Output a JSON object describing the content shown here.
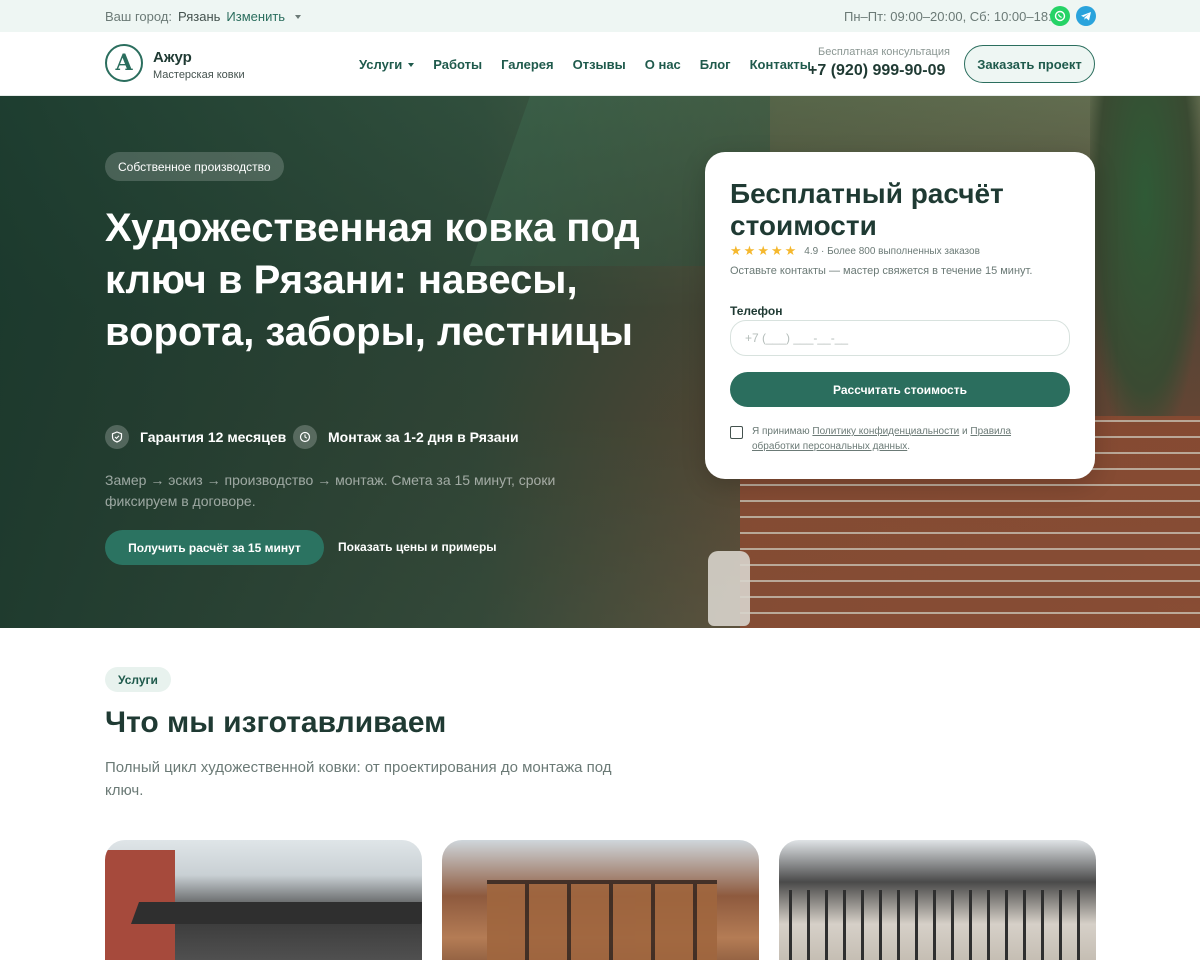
{
  "topbar": {
    "city_label": "Ваш город:",
    "city_name": "Рязань",
    "change_label": "Изменить",
    "hours": "Пн–Пт: 09:00–20:00, Сб: 10:00–18:00",
    "social": [
      "whatsapp-icon",
      "telegram-icon"
    ]
  },
  "header": {
    "logo_letter": "A",
    "logo_title": "Ажур",
    "logo_subtitle": "Мастерская ковки",
    "nav": [
      "Услуги",
      "Работы",
      "Галерея",
      "Отзывы",
      "О нас",
      "Блог",
      "Контакты"
    ],
    "consult_label": "Бесплатная консультация",
    "phone": "+7 (920) 999-90-09",
    "order_button": "Заказать проект"
  },
  "hero": {
    "badge": "Собственное производство",
    "title": "Художественная ковка под ключ в Рязани: навесы, ворота, заборы, лестницы",
    "features": [
      {
        "icon": "shield-icon",
        "label": "Гарантия 12 месяцев"
      },
      {
        "icon": "clock-icon",
        "label": "Монтаж за 1-2 дня в Рязани"
      }
    ],
    "description": "Замер → эскиз → производство → монтаж. Смета за 15 минут, сроки фиксируем в договоре.",
    "cta_primary": "Получить расчёт за 15 минут",
    "cta_secondary": "Показать цены и примеры"
  },
  "form": {
    "title": "Бесплатный расчёт стоимости",
    "rating_stars": 5,
    "rating_text": "4.9 · Более 800 выполненных заказов",
    "subtitle": "Оставьте контакты — мастер свяжется в течение 15 минут.",
    "phone_label": "Телефон",
    "phone_placeholder": "+7 (___) ___-__-__",
    "phone_value": "",
    "submit": "Рассчитать стоимость",
    "consent_prefix": "Я принимаю",
    "consent_link1": "Политику конфиденциальности",
    "consent_and": "и",
    "consent_link2": "Правила обработки персональных данных",
    "consent_checked": false
  },
  "services": {
    "badge": "Услуги",
    "title": "Что мы изготавливаем",
    "description": "Полный цикл художественной ковки: от проектирования до монтажа под ключ."
  },
  "colors": {
    "accent": "#2b6e5e",
    "dark": "#1f3a33",
    "topbar_bg": "#eef6f3",
    "star": "#f5b82e"
  }
}
